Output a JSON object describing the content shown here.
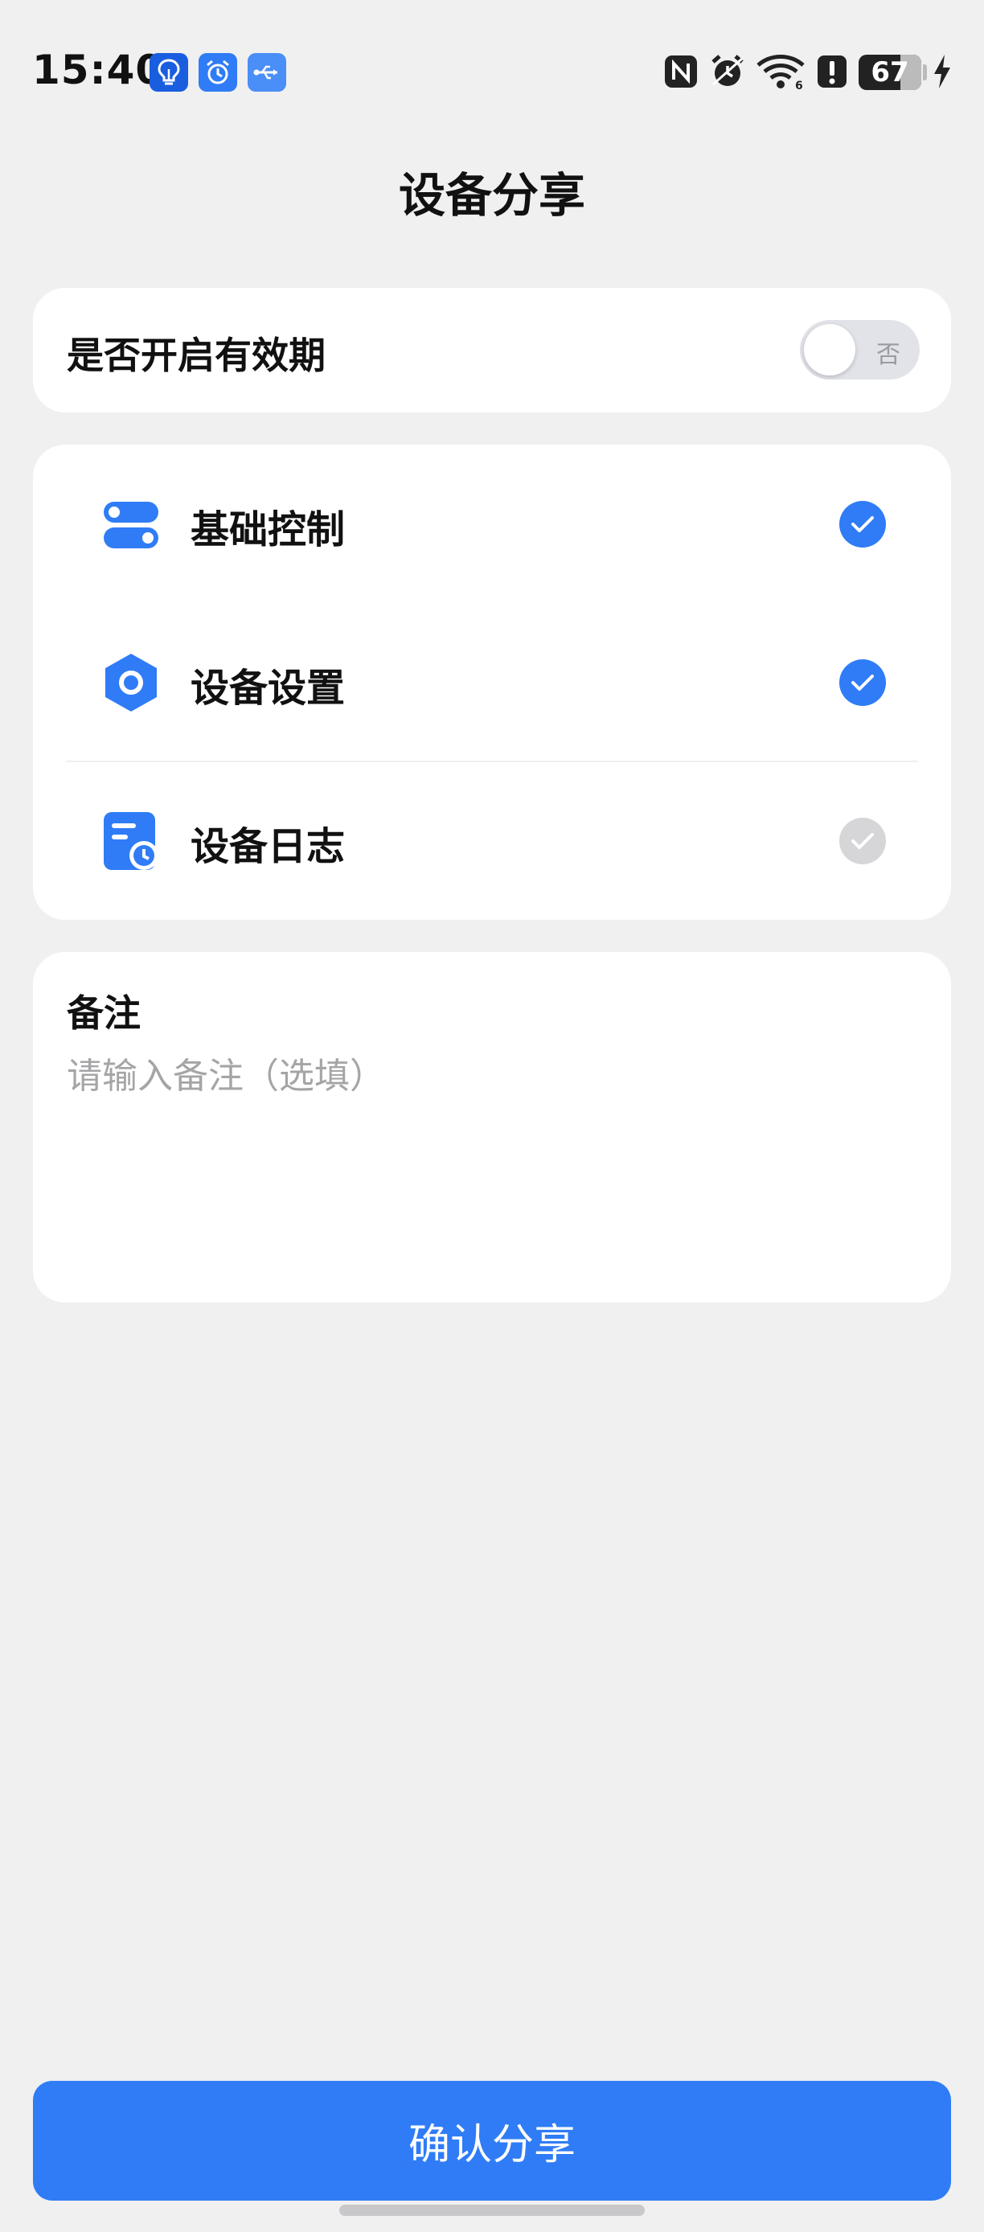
{
  "status_bar": {
    "time": "15:40",
    "notification_icons": [
      "lightbulb-app-icon",
      "alarm-app-icon",
      "usb-icon"
    ],
    "system_icons": [
      "nfc-icon",
      "alarm-icon",
      "wifi-icon",
      "alert-icon"
    ],
    "battery_level": "67",
    "charging": true
  },
  "header": {
    "title": "设备分享"
  },
  "validity": {
    "label": "是否开启有效期",
    "toggle_text": "否",
    "enabled": false
  },
  "permissions": {
    "items": [
      {
        "label": "基础控制",
        "icon": "toggle-switches-icon",
        "checked": true
      },
      {
        "label": "设备设置",
        "icon": "hexagon-settings-icon",
        "checked": true
      },
      {
        "label": "设备日志",
        "icon": "log-clock-icon",
        "checked": false
      }
    ]
  },
  "note": {
    "title": "备注",
    "placeholder": "请输入备注（选填）",
    "value": ""
  },
  "footer": {
    "confirm_label": "确认分享"
  },
  "colors": {
    "accent": "#2f7cf6",
    "background": "#f0f0f0",
    "card": "#ffffff",
    "unchecked": "#d6d6d8"
  }
}
